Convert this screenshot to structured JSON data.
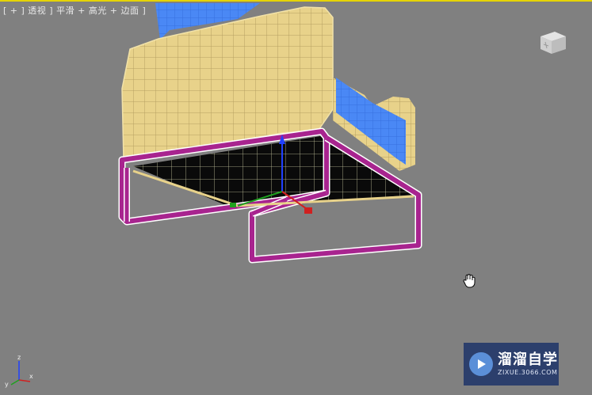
{
  "viewport": {
    "label_parts": [
      "[ + ]",
      "透视",
      "]",
      "平滑 + 高光 + 边面",
      "]"
    ]
  },
  "watermark": {
    "title": "溜溜自学",
    "url": "ZIXUE.3066.COM"
  },
  "axis": {
    "x_label": "x",
    "y_label": "y",
    "z_label": "z"
  },
  "colors": {
    "viewport_bg": "#808080",
    "active_border": "#e6d400",
    "cushion_wire": "#e3cf8a",
    "frame": "#a8248f",
    "backrest": "#3f7ff0",
    "watermark_bg": "#2c3f6c"
  },
  "icons": {
    "viewcube": "viewcube-icon",
    "cursor": "pan-hand-icon",
    "axis": "axis-tripod-icon",
    "logo": "play-logo-icon"
  }
}
